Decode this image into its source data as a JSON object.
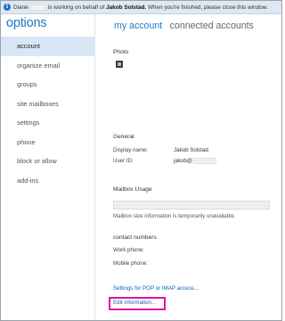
{
  "infobar": {
    "user_name": "Diane",
    "message_mid": "is working on behalf of",
    "target_name": "Jakob Solstad.",
    "message_end": "When you're finished, please close this window."
  },
  "sidebar": {
    "title": "options",
    "items": [
      {
        "label": "account",
        "selected": true
      },
      {
        "label": "organize email"
      },
      {
        "label": "groups"
      },
      {
        "label": "site mailboxes"
      },
      {
        "label": "settings"
      },
      {
        "label": "phone"
      },
      {
        "label": "block or allow"
      },
      {
        "label": "add-ins"
      }
    ]
  },
  "tabs": {
    "active": "my account",
    "inactive": "connected accounts"
  },
  "account": {
    "photo_label": "Photo",
    "general_heading": "General",
    "display_name_label": "Display name:",
    "display_name_value": "Jakob Solstad",
    "user_id_label": "User ID:",
    "user_id_value": "jakob@",
    "mailbox_usage_heading": "Mailbox Usage",
    "mailbox_usage_note": "Mailbox size information is temporarily unavailable.",
    "contact_numbers_heading": "contact numbers",
    "work_phone_label": "Work phone:",
    "mobile_phone_label": "Mobile phone:",
    "pop_imap_link": "Settings for POP or IMAP access...",
    "edit_link": "Edit information..."
  },
  "colors": {
    "accent": "#1a79c8",
    "nav_selected_bg": "#d7e7f6",
    "highlight": "#e0149e",
    "infobar_bg": "#dfe7f2"
  }
}
